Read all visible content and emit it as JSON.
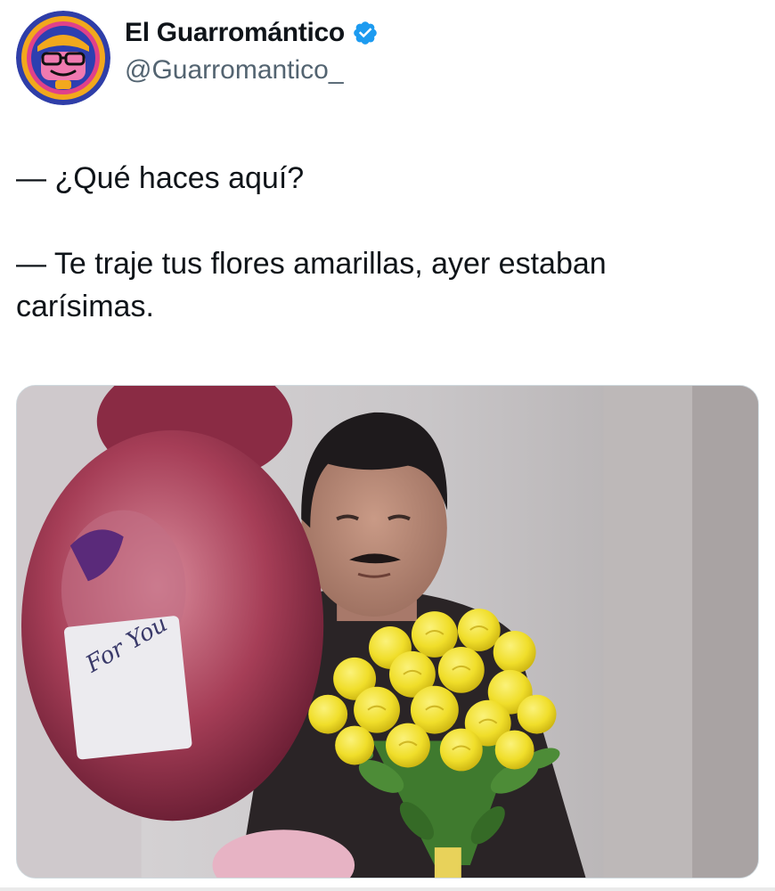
{
  "author": {
    "display_name": "El Guarromántico",
    "handle": "@Guarromantico_",
    "verified": true,
    "verified_badge_icon": "verified-check-icon",
    "avatar_icon": "cartoon-face-avatar",
    "verified_color": "#1d9bf0"
  },
  "tweet": {
    "lines": [
      "— ¿Qué haces aquí?",
      "— Te traje tus flores amarillas, ayer estaban carísimas."
    ]
  },
  "media": {
    "type": "photo",
    "note_text": "For You"
  },
  "colors": {
    "text": "#0f1419",
    "secondary_text": "#536471",
    "avatar_ring_outer": "#2f3ea8",
    "avatar_ring_inner": "#f2a81d",
    "rose_yellow": "#f3e233",
    "leaf_green": "#3f7a2e"
  }
}
